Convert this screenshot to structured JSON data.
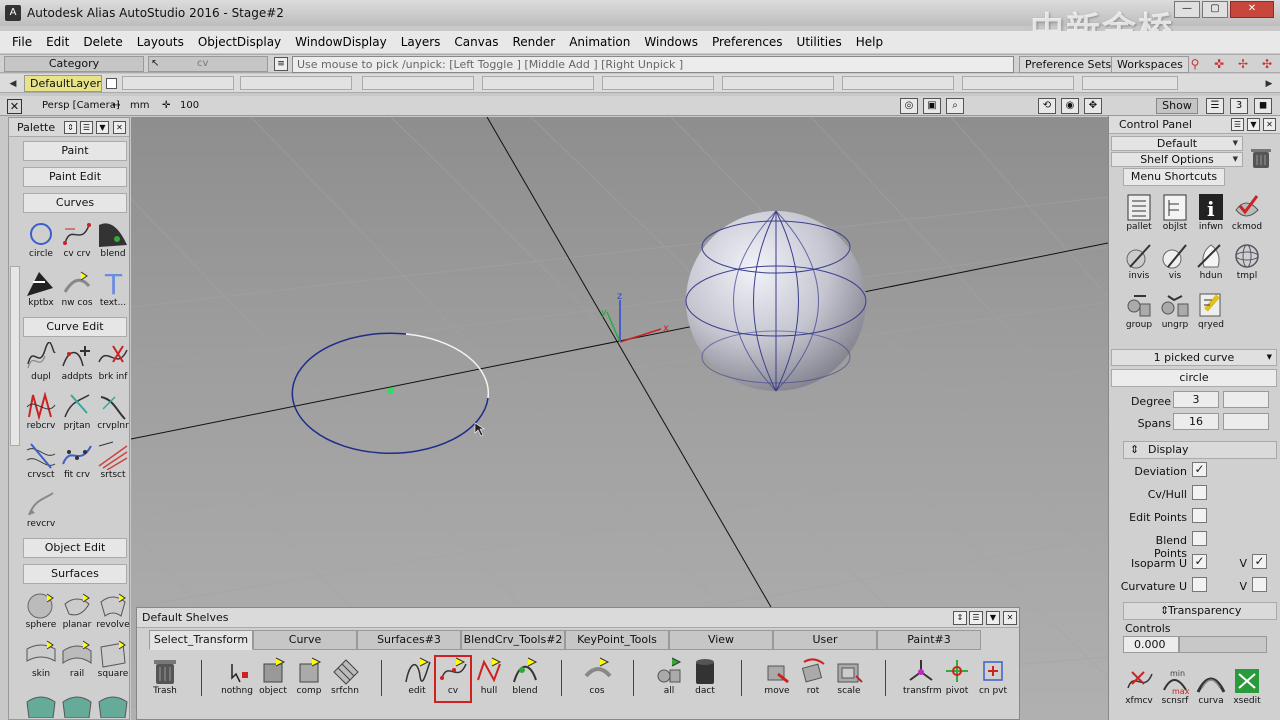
{
  "window": {
    "title": "Autodesk Alias AutoStudio 2016  - Stage#2",
    "watermark": "中新金桥"
  },
  "menubar": [
    "File",
    "Edit",
    "Delete",
    "Layouts",
    "ObjectDisplay",
    "WindowDisplay",
    "Layers",
    "Canvas",
    "Render",
    "Animation",
    "Windows",
    "Preferences",
    "Utilities",
    "Help"
  ],
  "toolbar": {
    "category": "Category",
    "pick_tool": "cv",
    "prompt": "Use mouse to pick /unpick: [Left Toggle ] [Middle Add ] [Right Unpick ]",
    "preference_sets": "Preference Sets",
    "workspaces": "Workspaces"
  },
  "layers": {
    "default": "DefaultLayer"
  },
  "viewbar": {
    "camera": "Persp [Camera]",
    "units": "mm",
    "scale": "100",
    "show": "Show",
    "number": "3"
  },
  "palette": {
    "title": "Palette",
    "sections": {
      "paint": "Paint",
      "paint_edit": "Paint Edit",
      "curves": "Curves",
      "curve_edit": "Curve Edit",
      "object_edit": "Object Edit",
      "surfaces": "Surfaces"
    },
    "curves_tools": [
      "circle",
      "cv crv",
      "blend",
      "kptbx",
      "nw cos",
      "text..."
    ],
    "curve_edit_tools": [
      "dupl",
      "addpts",
      "brk inf",
      "rebcrv",
      "prjtan",
      "crvplnr",
      "crvsct",
      "fit crv",
      "srtsct",
      "revcrv"
    ],
    "surfaces_tools": [
      "sphere",
      "planar",
      "revolve",
      "skin",
      "rail",
      "square"
    ]
  },
  "viewport": {
    "axis_x": "x",
    "axis_y": "y",
    "axis_z": "z"
  },
  "control_panel": {
    "title": "Control Panel",
    "default": "Default",
    "shelf_options": "Shelf Options",
    "menu_shortcuts": "Menu Shortcuts",
    "shortcuts": [
      "pallet",
      "objlst",
      "infwn",
      "ckmod",
      "invis",
      "vis",
      "hdun",
      "tmpl",
      "group",
      "ungrp",
      "qryed"
    ],
    "picked": "1 picked curve",
    "object_name": "circle",
    "degree_label": "Degree",
    "degree_value": "3",
    "spans_label": "Spans",
    "spans_value": "16",
    "display_label": "Display",
    "deviation": "Deviation",
    "cvhull": "Cv/Hull",
    "edit_points": "Edit Points",
    "blend_points": "Blend Points",
    "isoparm_u": "Isoparm U",
    "curvature_u": "Curvature U",
    "v_label": "V",
    "transparency": "Transparency",
    "controls": "Controls",
    "controls_value": "0.000",
    "bottom_tools": [
      "xfmcv",
      "scnsrf",
      "curva",
      "xsedit"
    ]
  },
  "shelves": {
    "title": "Default Shelves",
    "tabs": [
      "Select_Transform",
      "Curve",
      "Surfaces#3",
      "BlendCrv_Tools#2",
      "KeyPoint_Tools",
      "View",
      "User",
      "Paint#3"
    ],
    "trash": "Trash",
    "tools": [
      "nothng",
      "object",
      "comp",
      "srfchn",
      "edit",
      "cv",
      "hull",
      "blend",
      "cos",
      "all",
      "dact",
      "move",
      "rot",
      "scale",
      "transfrm",
      "pivot",
      "cn pvt"
    ]
  }
}
